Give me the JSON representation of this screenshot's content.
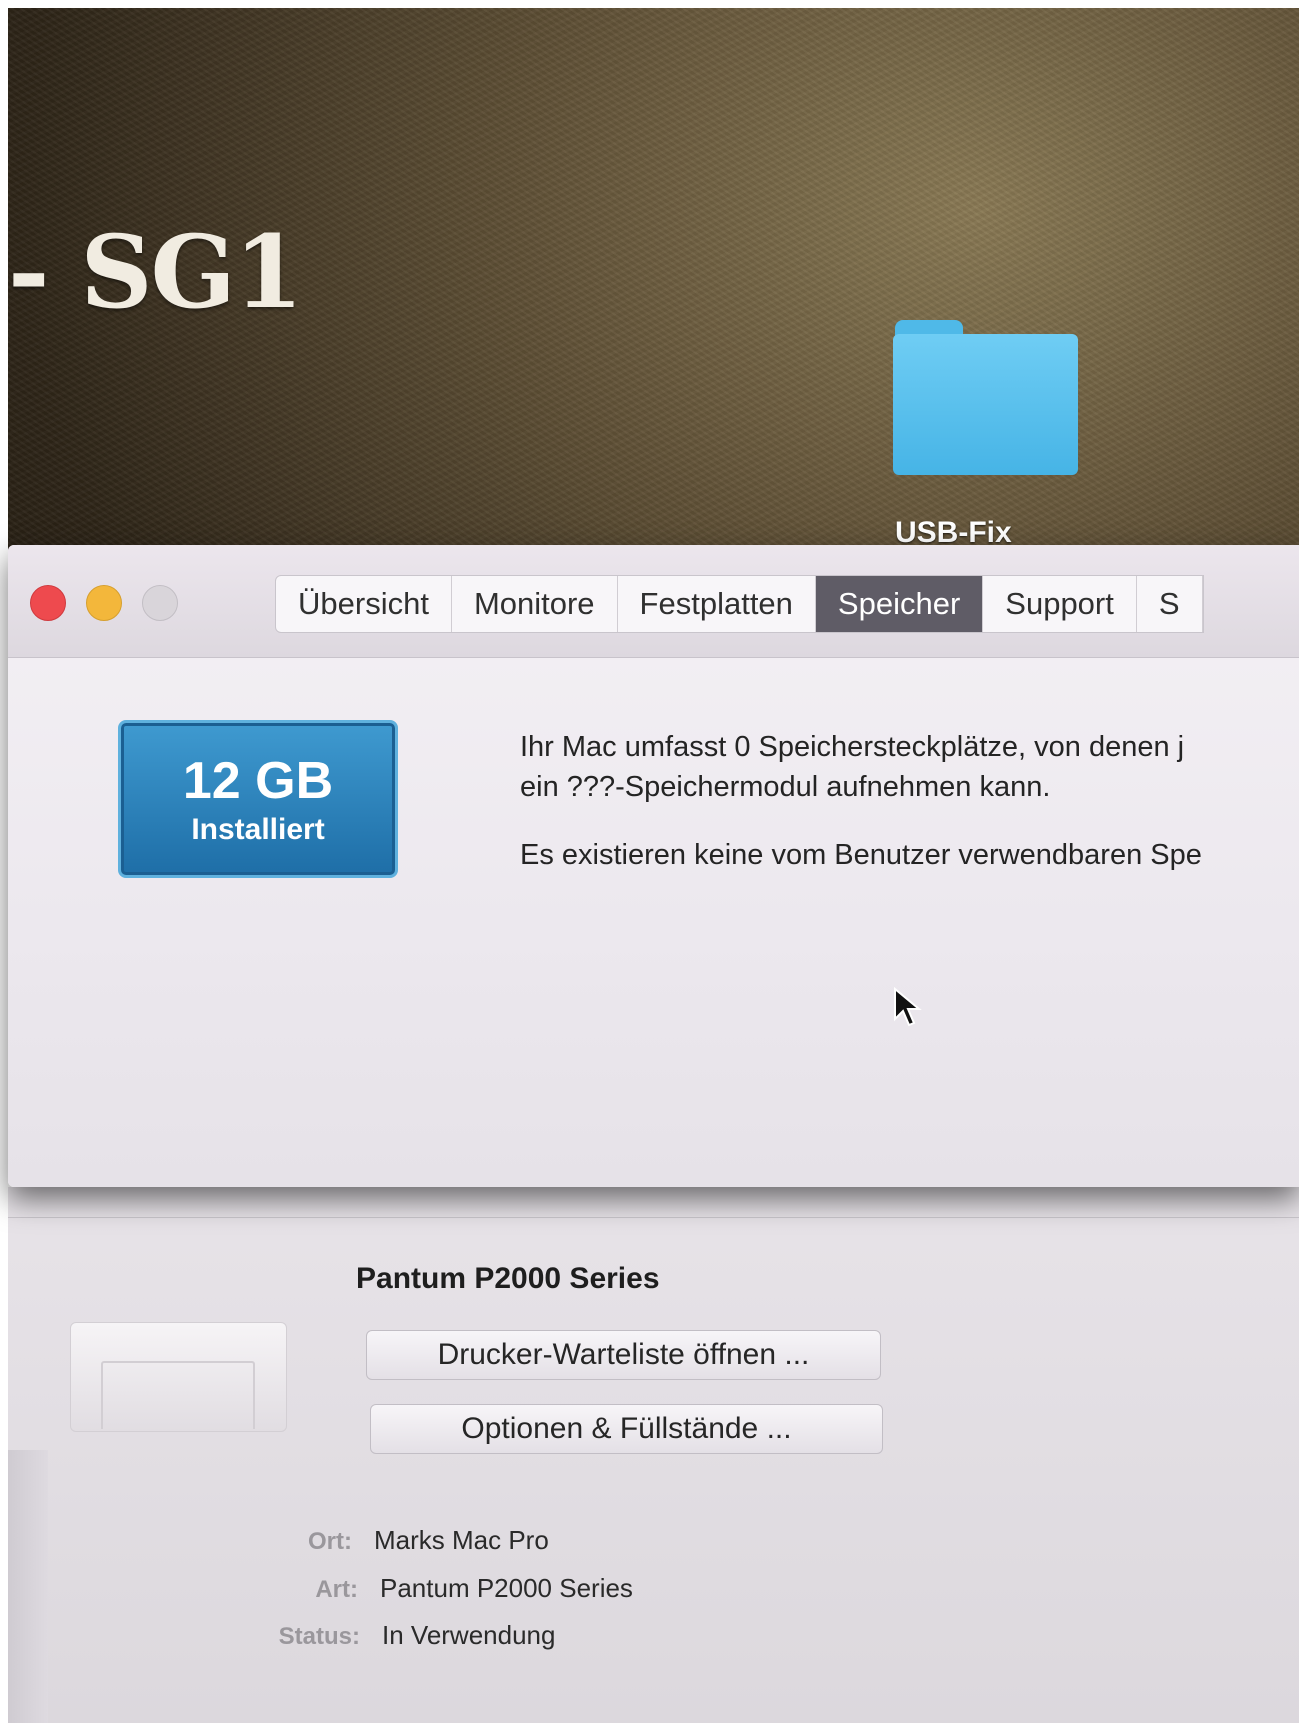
{
  "desktop": {
    "volume_title": "- SG1",
    "folder_label": "USB-Fix"
  },
  "window": {
    "tabs": [
      {
        "label": "Übersicht",
        "active": false
      },
      {
        "label": "Monitore",
        "active": false
      },
      {
        "label": "Festplatten",
        "active": false
      },
      {
        "label": "Speicher",
        "active": true
      },
      {
        "label": "Support",
        "active": false
      },
      {
        "label": "S",
        "active": false
      }
    ],
    "memory": {
      "value": "12 GB",
      "label": "Installiert"
    },
    "info_line_1": "Ihr Mac umfasst 0 Speichersteckplätze, von denen j",
    "info_line_2": "ein ???-Speichermodul aufnehmen kann.",
    "info_line_3": "Es existieren keine vom Benutzer verwendbaren Spe"
  },
  "printer": {
    "name": "Pantum P2000 Series",
    "queue_button": "Drucker-Warteliste öffnen ...",
    "options_button": "Optionen & Füllstände ...",
    "location_key": "Ort:",
    "location_value": "Marks Mac Pro",
    "kind_key": "Art:",
    "kind_value": "Pantum P2000 Series",
    "status_key": "Status:",
    "status_value": "In Verwendung"
  },
  "colors": {
    "active_tab": "#5f5c66",
    "memory_badge": "#2a7fbb",
    "folder": "#56bdea"
  }
}
